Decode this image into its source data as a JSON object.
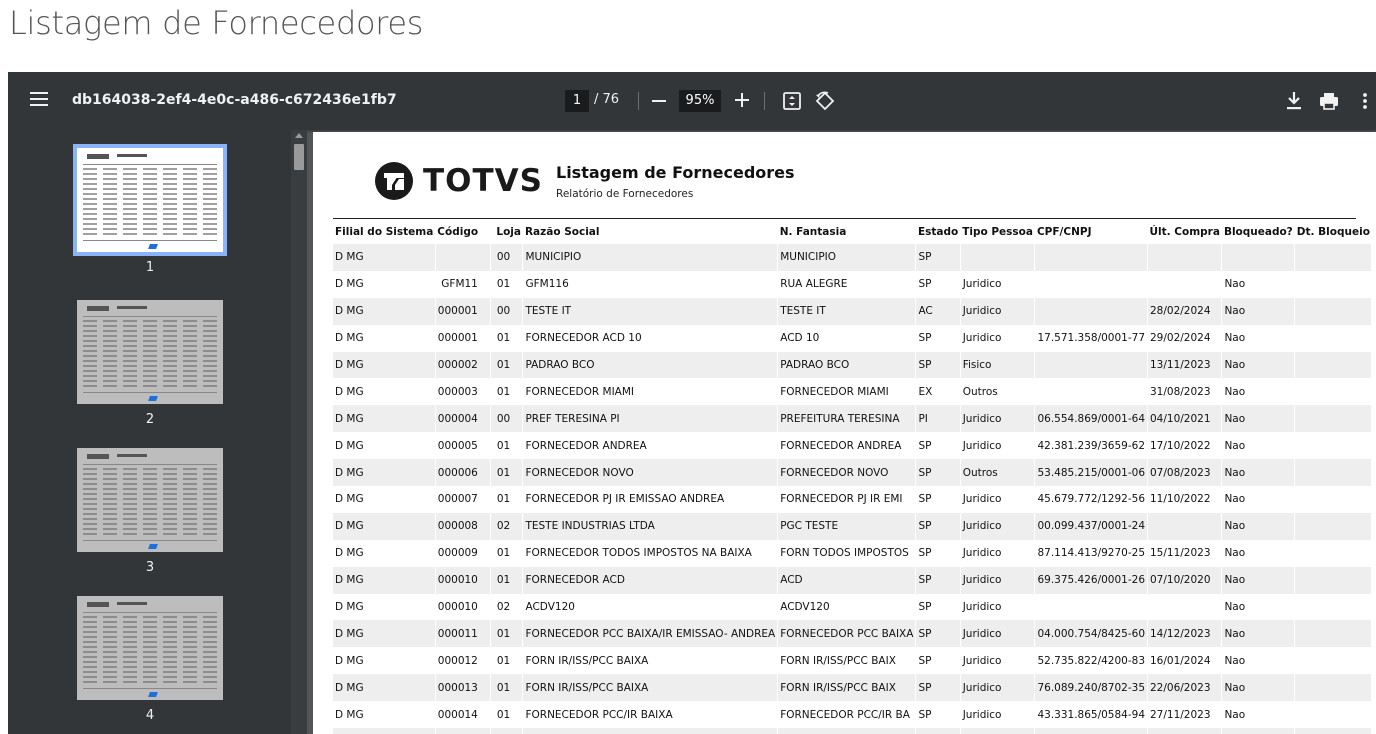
{
  "page": {
    "heading": "Listagem de Fornecedores"
  },
  "toolbar": {
    "file_name": "db164038-2ef4-4e0c-a486-c672436e1fb7",
    "current_page": "1",
    "total_pages": "/ 76",
    "zoom": "95%",
    "icons": [
      "menu-icon",
      "zoom-out-icon",
      "zoom-in-icon",
      "fit-page-icon",
      "rotate-icon",
      "download-icon",
      "print-icon",
      "more-options-icon"
    ]
  },
  "sidebar": {
    "thumbnails": [
      {
        "label": "1",
        "active": true
      },
      {
        "label": "2",
        "active": false
      },
      {
        "label": "3",
        "active": false
      },
      {
        "label": "4",
        "active": false
      }
    ]
  },
  "document": {
    "logo_text": "TOTVS",
    "title": "Listagem de Fornecedores",
    "subtitle": "Relatório de Fornecedores",
    "columns": [
      "Filial do Sistema",
      "Código",
      "Loja",
      "Razão Social",
      "N. Fantasia",
      "Estado",
      "Tipo Pessoa",
      "CPF/CNPJ",
      "Últ. Compra",
      "Bloqueado?",
      "Dt. Bloqueio"
    ],
    "rows": [
      [
        "D MG",
        "",
        "00",
        "MUNICIPIO",
        "MUNICIPIO",
        "SP",
        "",
        "",
        "",
        "",
        ""
      ],
      [
        "D MG",
        "GFM11",
        "01",
        "GFM116",
        "RUA ALEGRE",
        "SP",
        "Juridico",
        "",
        "",
        "Nao",
        ""
      ],
      [
        "D MG",
        "000001",
        "00",
        "TESTE IT",
        "TESTE IT",
        "AC",
        "Juridico",
        "",
        "28/02/2024",
        "Nao",
        ""
      ],
      [
        "D MG",
        "000001",
        "01",
        "FORNECEDOR ACD 10",
        "ACD 10",
        "SP",
        "Juridico",
        "17.571.358/0001-77",
        "29/02/2024",
        "Nao",
        ""
      ],
      [
        "D MG",
        "000002",
        "01",
        "PADRAO BCO",
        "PADRAO BCO",
        "SP",
        "Fisico",
        "",
        "13/11/2023",
        "Nao",
        ""
      ],
      [
        "D MG",
        "000003",
        "01",
        "FORNECEDOR MIAMI",
        "FORNECEDOR MIAMI",
        "EX",
        "Outros",
        "",
        "31/08/2023",
        "Nao",
        ""
      ],
      [
        "D MG",
        "000004",
        "00",
        "PREF TERESINA PI",
        "PREFEITURA TERESINA",
        "PI",
        "Juridico",
        "06.554.869/0001-64",
        "04/10/2021",
        "Nao",
        ""
      ],
      [
        "D MG",
        "000005",
        "01",
        "FORNECEDOR ANDREA",
        "FORNECEDOR ANDREA",
        "SP",
        "Juridico",
        "42.381.239/3659-62",
        "17/10/2022",
        "Nao",
        ""
      ],
      [
        "D MG",
        "000006",
        "01",
        "FORNECEDOR NOVO",
        "FORNECEDOR NOVO",
        "SP",
        "Outros",
        "53.485.215/0001-06",
        "07/08/2023",
        "Nao",
        ""
      ],
      [
        "D MG",
        "000007",
        "01",
        "FORNECEDOR PJ IR EMISSAO ANDREA",
        "FORNECEDOR PJ IR EMI",
        "SP",
        "Juridico",
        "45.679.772/1292-56",
        "11/10/2022",
        "Nao",
        ""
      ],
      [
        "D MG",
        "000008",
        "02",
        "TESTE INDUSTRIAS LTDA",
        "PGC TESTE",
        "SP",
        "Juridico",
        "00.099.437/0001-24",
        "",
        "Nao",
        ""
      ],
      [
        "D MG",
        "000009",
        "01",
        "FORNECEDOR TODOS IMPOSTOS NA BAIXA",
        "FORN TODOS IMPOSTOS",
        "SP",
        "Juridico",
        "87.114.413/9270-25",
        "15/11/2023",
        "Nao",
        ""
      ],
      [
        "D MG",
        "000010",
        "01",
        "FORNECEDOR ACD",
        "ACD",
        "SP",
        "Juridico",
        "69.375.426/0001-26",
        "07/10/2020",
        "Nao",
        ""
      ],
      [
        "D MG",
        "000010",
        "02",
        "ACDV120",
        "ACDV120",
        "SP",
        "Juridico",
        "",
        "",
        "Nao",
        ""
      ],
      [
        "D MG",
        "000011",
        "01",
        "FORNECEDOR PCC BAIXA/IR EMISSAO- ANDREA",
        "FORNECEDOR PCC BAIXA",
        "SP",
        "Juridico",
        "04.000.754/8425-60",
        "14/12/2023",
        "Nao",
        ""
      ],
      [
        "D MG",
        "000012",
        "01",
        "FORN IR/ISS/PCC BAIXA",
        "FORN IR/ISS/PCC BAIX",
        "SP",
        "Juridico",
        "52.735.822/4200-83",
        "16/01/2024",
        "Nao",
        ""
      ],
      [
        "D MG",
        "000013",
        "01",
        "FORN IR/ISS/PCC BAIXA",
        "FORN IR/ISS/PCC BAIX",
        "SP",
        "Juridico",
        "76.089.240/8702-35",
        "22/06/2023",
        "Nao",
        ""
      ],
      [
        "D MG",
        "000014",
        "01",
        "FORNECEDOR PCC/IR BAIXA",
        "FORNECEDOR PCC/IR BA",
        "SP",
        "Juridico",
        "43.331.865/0584-94",
        "27/11/2023",
        "Nao",
        ""
      ],
      [
        "",
        "",
        "",
        "",
        "",
        "",
        "",
        "",
        "",
        "",
        ""
      ]
    ]
  }
}
